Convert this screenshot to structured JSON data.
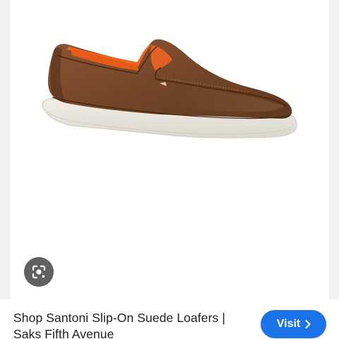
{
  "product": {
    "title": "Shop Santoni Slip-On Suede Loafers | Saks Fifth Avenue",
    "image_icon": "brown-suede-loafer-image"
  },
  "lens": {
    "icon": "camera-search-icon"
  },
  "visit": {
    "label": "Visit",
    "icon": "chevron-right-icon"
  },
  "colors": {
    "accent": "#1a73e8",
    "lens_button": "#5f6163",
    "shoe_suede": "#7a4a2b",
    "shoe_lining": "#f26522",
    "sole": "#ece8df"
  }
}
